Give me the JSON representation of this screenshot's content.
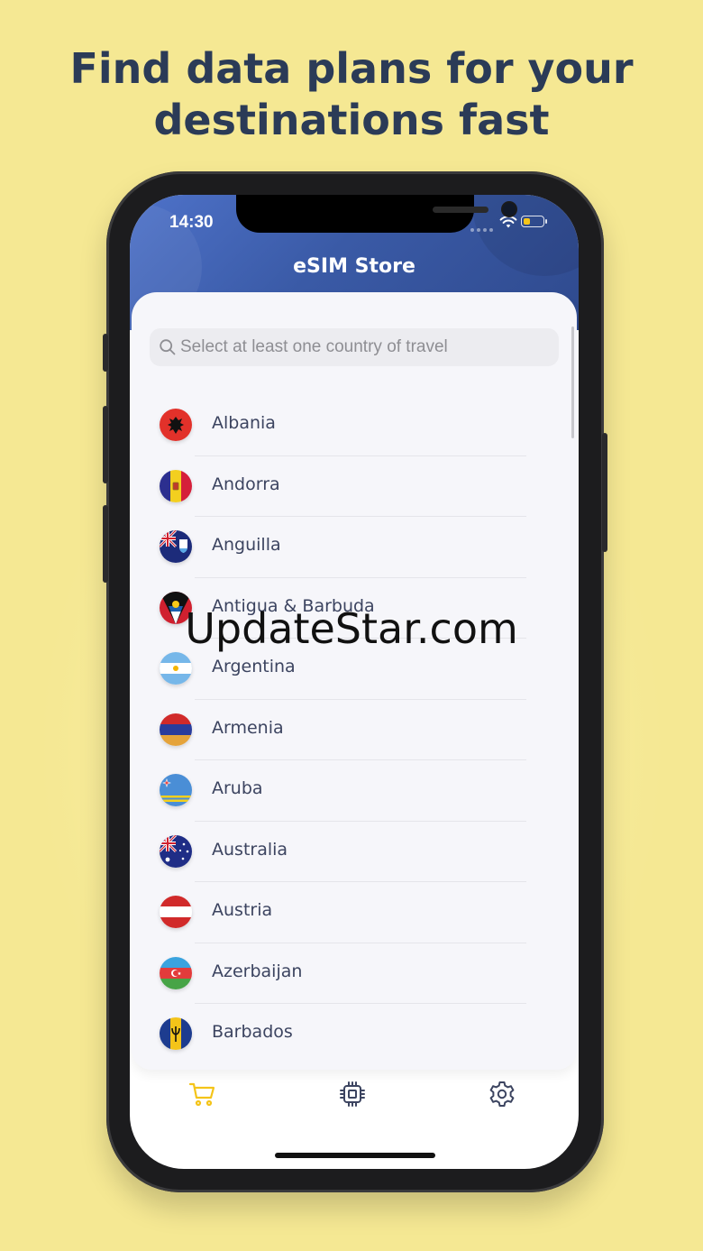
{
  "headline": {
    "line1": "Find data plans for your",
    "line2": "destinations fast"
  },
  "status_bar": {
    "time": "14:30",
    "battery_level": 0.35,
    "battery_color": "#f4c419"
  },
  "header": {
    "title": "eSIM Store",
    "gradient_colors": [
      "#4e72c9",
      "#2f4a8e"
    ]
  },
  "search": {
    "placeholder": "Select at least one country of travel",
    "icon": "search-icon"
  },
  "countries": [
    {
      "name": "Albania",
      "flag": "albania-flag-icon"
    },
    {
      "name": "Andorra",
      "flag": "andorra-flag-icon"
    },
    {
      "name": "Anguilla",
      "flag": "anguilla-flag-icon"
    },
    {
      "name": "Antigua & Barbuda",
      "flag": "antigua-barbuda-flag-icon"
    },
    {
      "name": "Argentina",
      "flag": "argentina-flag-icon"
    },
    {
      "name": "Armenia",
      "flag": "armenia-flag-icon"
    },
    {
      "name": "Aruba",
      "flag": "aruba-flag-icon"
    },
    {
      "name": "Australia",
      "flag": "australia-flag-icon"
    },
    {
      "name": "Austria",
      "flag": "austria-flag-icon"
    },
    {
      "name": "Azerbaijan",
      "flag": "azerbaijan-flag-icon"
    },
    {
      "name": "Barbados",
      "flag": "barbados-flag-icon"
    }
  ],
  "tabbar": {
    "active_color": "#f4c419",
    "inactive_color": "#3c4460",
    "items": [
      {
        "icon": "cart-icon",
        "active": true
      },
      {
        "icon": "chip-icon",
        "active": false
      },
      {
        "icon": "gear-icon",
        "active": false
      }
    ]
  },
  "watermark": "UpdateStar.com",
  "colors": {
    "background": "#f5e893",
    "headline": "#2b3b57",
    "list_text": "#3c4460"
  }
}
